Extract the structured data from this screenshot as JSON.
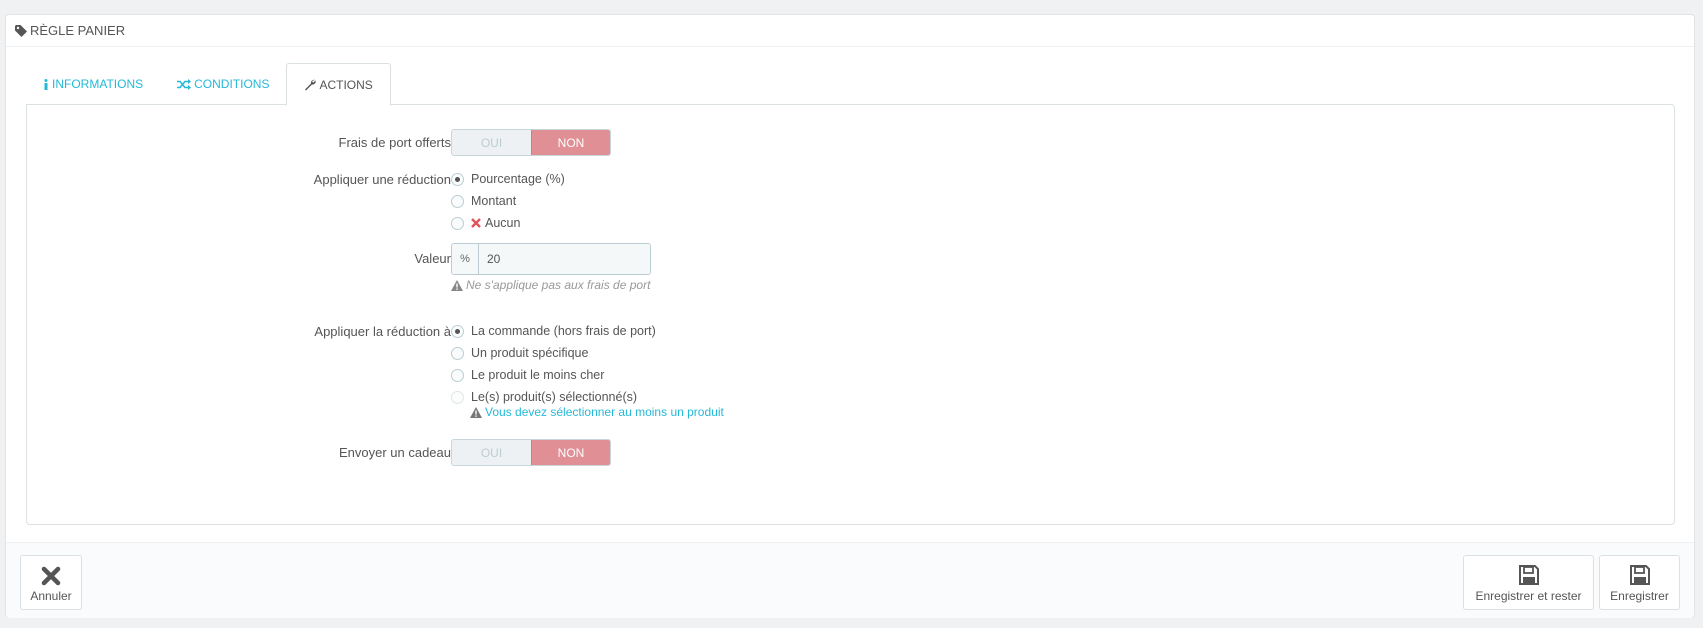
{
  "panel": {
    "title": "Règle panier"
  },
  "tabs": [
    {
      "label": "Informations",
      "icon": "info-icon"
    },
    {
      "label": "Conditions",
      "icon": "shuffle-icon"
    },
    {
      "label": "Actions",
      "icon": "wrench-icon",
      "active": true
    }
  ],
  "form": {
    "free_shipping": {
      "label": "Frais de port offerts",
      "yes": "OUI",
      "no": "NON",
      "value": "NON"
    },
    "apply_discount": {
      "label": "Appliquer une réduction",
      "options": [
        "Pourcentage (%)",
        "Montant",
        "Aucun"
      ],
      "selected": "Pourcentage (%)"
    },
    "value": {
      "label": "Valeur",
      "addon": "%",
      "value": "20",
      "help": "Ne s'applique pas aux frais de port"
    },
    "apply_to": {
      "label": "Appliquer la réduction à",
      "options": [
        "La commande (hors frais de port)",
        "Un produit spécifique",
        "Le produit le moins cher",
        "Le(s) produit(s) sélectionné(s)"
      ],
      "selected": "La commande (hors frais de port)",
      "warning": "Vous devez sélectionner au moins un produit"
    },
    "gift": {
      "label": "Envoyer un cadeau",
      "yes": "OUI",
      "no": "NON",
      "value": "NON"
    }
  },
  "footer": {
    "cancel": "Annuler",
    "save_stay": "Enregistrer et rester",
    "save": "Enregistrer"
  },
  "colors": {
    "accent": "#25b9d7",
    "no_active": "#e08f95"
  }
}
